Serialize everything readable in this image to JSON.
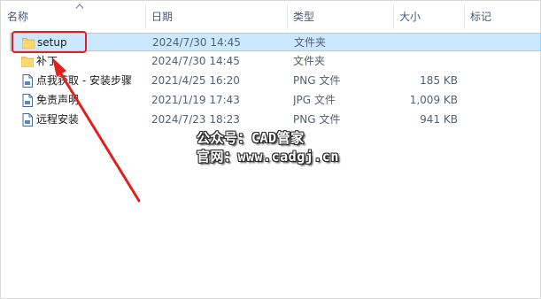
{
  "columns": {
    "name": "名称",
    "date": "日期",
    "type": "类型",
    "size": "大小",
    "tag": "标记"
  },
  "files": [
    {
      "name": "setup",
      "date": "2024/7/30 14:45",
      "type": "文件夹",
      "size": "",
      "icon": "folder-icon",
      "selected": true
    },
    {
      "name": "补丁",
      "date": "2024/7/30 14:45",
      "type": "文件夹",
      "size": "",
      "icon": "folder-icon",
      "selected": false
    },
    {
      "name": "点我获取 - 安装步骤",
      "date": "2021/4/25 16:20",
      "type": "PNG 文件",
      "size": "185 KB",
      "icon": "image-file-icon",
      "selected": false
    },
    {
      "name": "免责声明",
      "date": "2021/1/19 17:43",
      "type": "JPG 文件",
      "size": "1,009 KB",
      "icon": "image-file-icon",
      "selected": false
    },
    {
      "name": "远程安装",
      "date": "2024/7/23 18:23",
      "type": "PNG 文件",
      "size": "941 KB",
      "icon": "image-file-icon",
      "selected": false
    }
  ],
  "watermark": {
    "line1": "公众号：CAD管家",
    "line2": "官网：www.cadgj.cn"
  },
  "colors": {
    "selection_bg": "#cce8ff",
    "selection_border": "#99d1ff",
    "annotation_red": "#e0201f",
    "folder_yellow": "#f8cf5c"
  }
}
